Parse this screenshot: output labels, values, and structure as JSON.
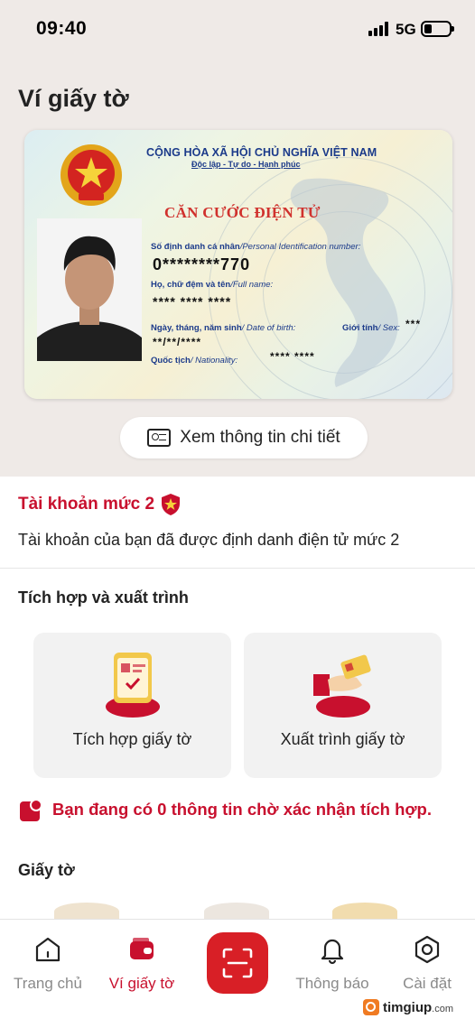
{
  "status_bar": {
    "time": "09:40",
    "network": "5G"
  },
  "header": {
    "title": "Ví giấy tờ"
  },
  "id_card": {
    "country_line": "CỘNG HÒA XÃ HỘI CHỦ NGHĨA VIỆT NAM",
    "motto": "Độc lập - Tự do - Hạnh phúc",
    "card_title": "CĂN CƯỚC ĐIỆN TỬ",
    "id_label": "Số định danh cá nhân",
    "id_label_en": "/Personal Identification number:",
    "id_value": "0********770",
    "name_label": "Họ, chữ đệm và tên",
    "name_label_en": "/Full name:",
    "name_value": "**** **** ****",
    "dob_label": "Ngày, tháng, năm sinh",
    "dob_label_en": "/ Date of birth:",
    "dob_value": "**/**/****",
    "sex_label": "Giới tính",
    "sex_label_en": "/ Sex:",
    "sex_value": "***",
    "nationality_label": "Quốc tịch",
    "nationality_label_en": "/ Nationality:",
    "nationality_value": "**** ****"
  },
  "detail_button": {
    "label": "Xem thông tin chi tiết"
  },
  "account": {
    "level": "Tài khoản mức 2",
    "description": "Tài khoản của bạn đã được định danh điện tử mức 2"
  },
  "integration": {
    "title": "Tích hợp và xuất trình",
    "tiles": [
      {
        "label": "Tích hợp giấy tờ"
      },
      {
        "label": "Xuất trình giấy tờ"
      }
    ]
  },
  "pending_notice": "Bạn đang có 0 thông tin chờ xác nhận tích hợp.",
  "documents": {
    "title": "Giấy tờ"
  },
  "tabbar": {
    "items": [
      {
        "label": "Trang chủ",
        "icon": "home-icon"
      },
      {
        "label": "Ví giấy tờ",
        "icon": "wallet-icon"
      },
      {
        "label": "Thông báo",
        "icon": "bell-icon"
      },
      {
        "label": "Cài đặt",
        "icon": "settings-icon"
      }
    ],
    "active_index": 1
  },
  "watermark": {
    "brand": "timgiup",
    "suffix": ".com"
  },
  "colors": {
    "accent": "#c8102e",
    "scan": "#d81f26",
    "hero_bg": "#efeae7"
  }
}
